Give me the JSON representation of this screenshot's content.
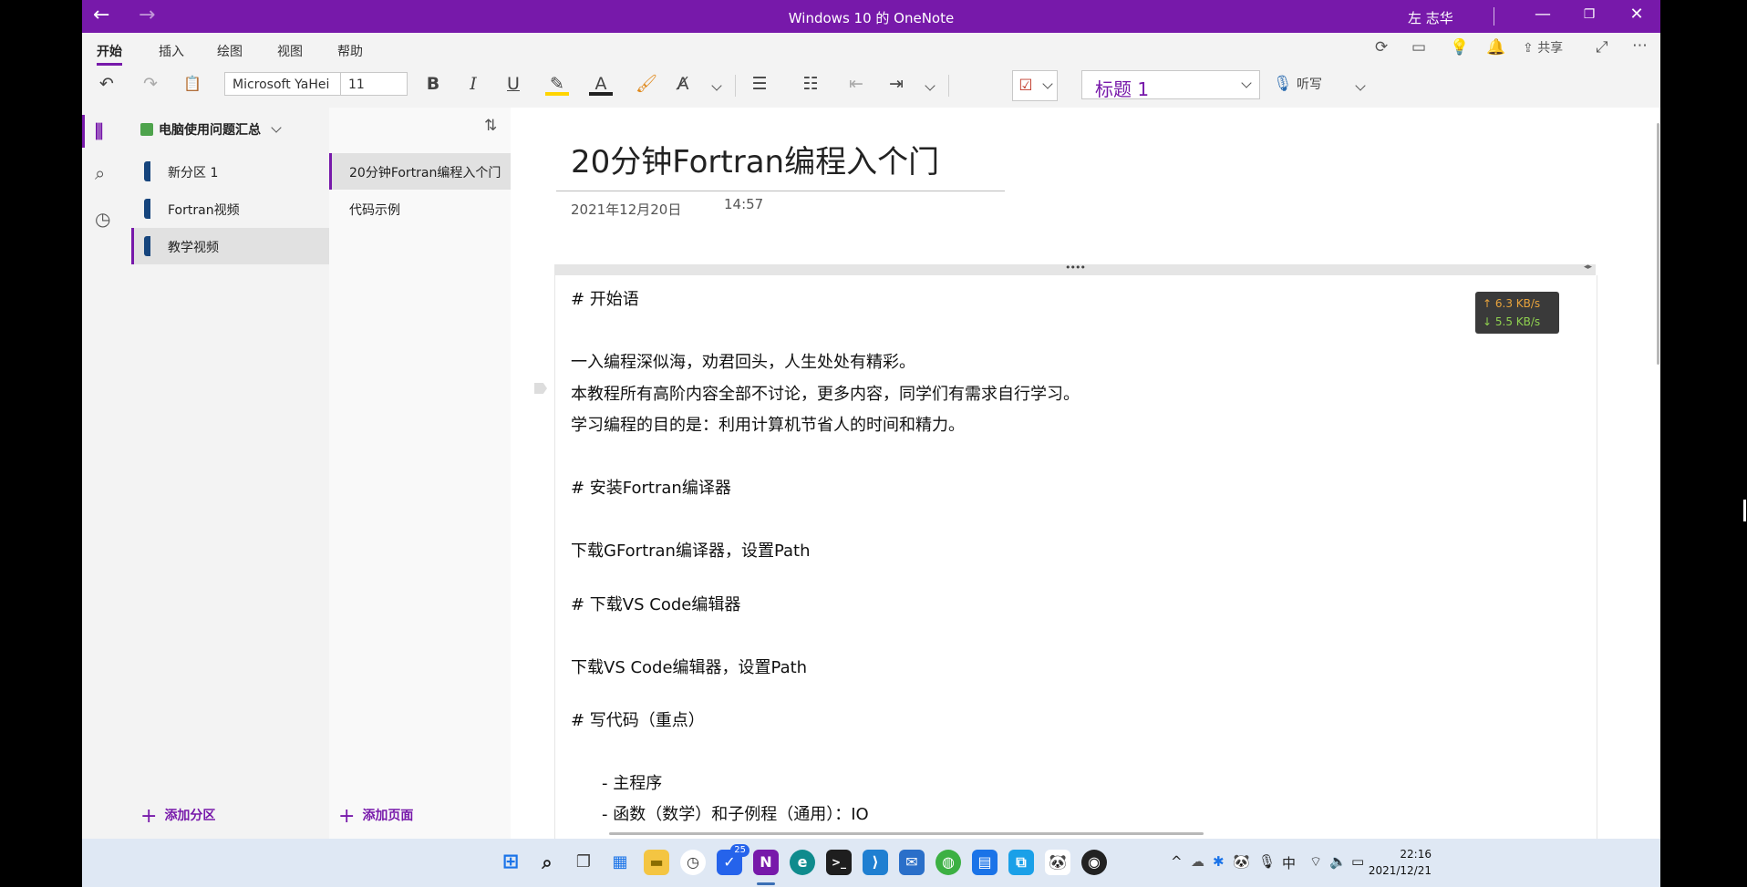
{
  "titlebar": {
    "title": "Windows 10 的 OneNote",
    "user": "左 志华"
  },
  "ribbon": {
    "tabs": [
      "开始",
      "插入",
      "绘图",
      "视图",
      "帮助"
    ],
    "active_tab": "开始",
    "share_label": "共享",
    "font_name": "Microsoft YaHei",
    "font_size": "11",
    "style_value": "标题 1",
    "dictate_label": "听写"
  },
  "notebook": {
    "name": "电脑使用问题汇总",
    "sections": [
      {
        "label": "新分区 1",
        "color": "#16457d"
      },
      {
        "label": "Fortran视频",
        "color": "#16457d"
      },
      {
        "label": "教学视频",
        "color": "#16457d"
      }
    ],
    "selected_section": "教学视频",
    "add_section_label": "添加分区"
  },
  "pages": {
    "items": [
      "20分钟Fortran编程入个门",
      "代码示例"
    ],
    "selected_page": "20分钟Fortran编程入个门",
    "add_page_label": "添加页面"
  },
  "note": {
    "title": "20分钟Fortran编程入个门",
    "date": "2021年12月20日",
    "time": "14:57",
    "lines": [
      "# 开始语",
      "一入编程深似海，劝君回头，人生处处有精彩。",
      "本教程所有高阶内容全部不讨论，更多内容，同学们有需求自行学习。",
      "学习编程的目的是：利用计算机节省人的时间和精力。",
      "#  安装Fortran编译器",
      "下载GFortran编译器，设置Path",
      "#  下载VS Code编辑器",
      "下载VS Code编辑器，设置Path",
      "#  写代码（重点）",
      "-    主程序",
      "-    函数（数学）和子例程（通用）：IO"
    ]
  },
  "overlay": {
    "upload": "↑ 6.3 KB/s",
    "download": "↓ 5.5 KB/s"
  },
  "taskbar": {
    "mail_badge": "25",
    "ime": "中",
    "time": "22:16",
    "date": "2021/12/21"
  },
  "colors": {
    "accent": "#7719aa",
    "taskbar": "#dfe8f4"
  }
}
